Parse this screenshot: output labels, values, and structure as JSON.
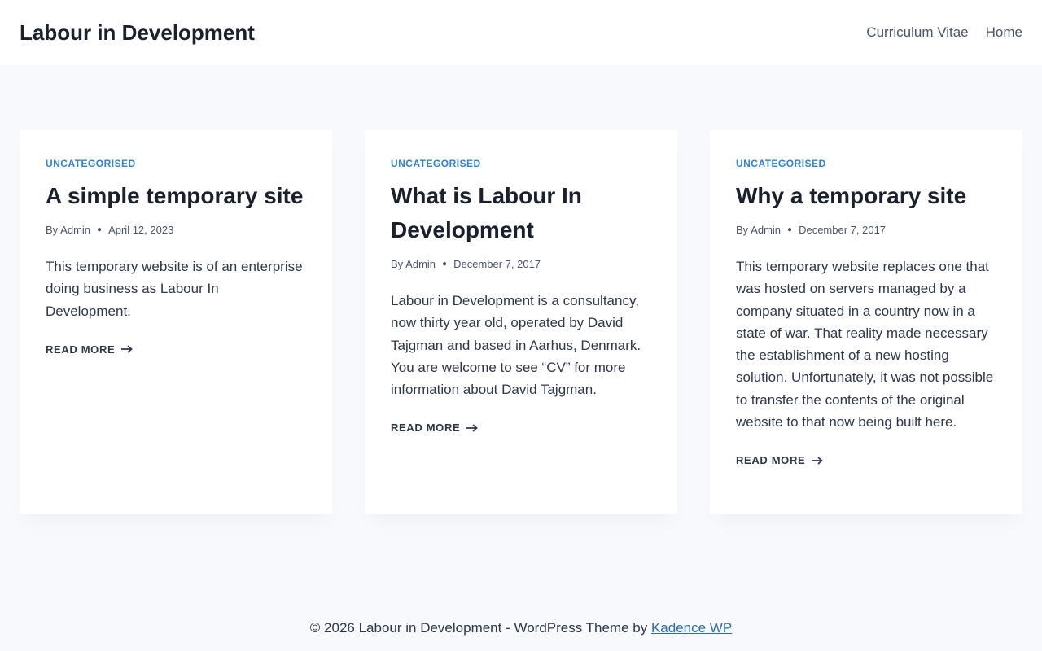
{
  "header": {
    "site_title": "Labour in Development",
    "nav": [
      {
        "label": "Curriculum Vitae"
      },
      {
        "label": "Home"
      }
    ]
  },
  "posts": [
    {
      "category": "UNCATEGORISED",
      "title": "A simple temporary site",
      "by": "By",
      "author": "Admin",
      "date": "April 12, 2023",
      "excerpt": "This temporary website is of an enterprise doing business as Labour In Development.",
      "read_more": "READ MORE"
    },
    {
      "category": "UNCATEGORISED",
      "title": "What is Labour In Development",
      "by": "By",
      "author": "Admin",
      "date": "December 7, 2017",
      "excerpt": "Labour in Development is a consultancy, now thirty year old, operated by David Tajgman and based in Aarhus, Denmark. You are welcome to see “CV” for more information about David Tajgman.",
      "read_more": "READ MORE"
    },
    {
      "category": "UNCATEGORISED",
      "title": "Why a temporary site",
      "by": "By",
      "author": "Admin",
      "date": "December 7, 2017",
      "excerpt": "This temporary website replaces one that was hosted on servers managed by a company situated in a country now in a state of war.  That reality made necessary the establishment of a new hosting solution.  Unfortunately, it was not possible to transfer the contents of the original website to that now being built here.",
      "read_more": "READ MORE"
    }
  ],
  "footer": {
    "text": "© 2026 Labour in Development - WordPress Theme by ",
    "link_label": "Kadence WP"
  },
  "colors": {
    "background": "#f7f9fc",
    "accent": "#3182ce",
    "text": "#1a202c"
  },
  "icons": {
    "read_more_arrow": "long-arrow-right-icon",
    "meta_separator": "bullet-dot"
  }
}
